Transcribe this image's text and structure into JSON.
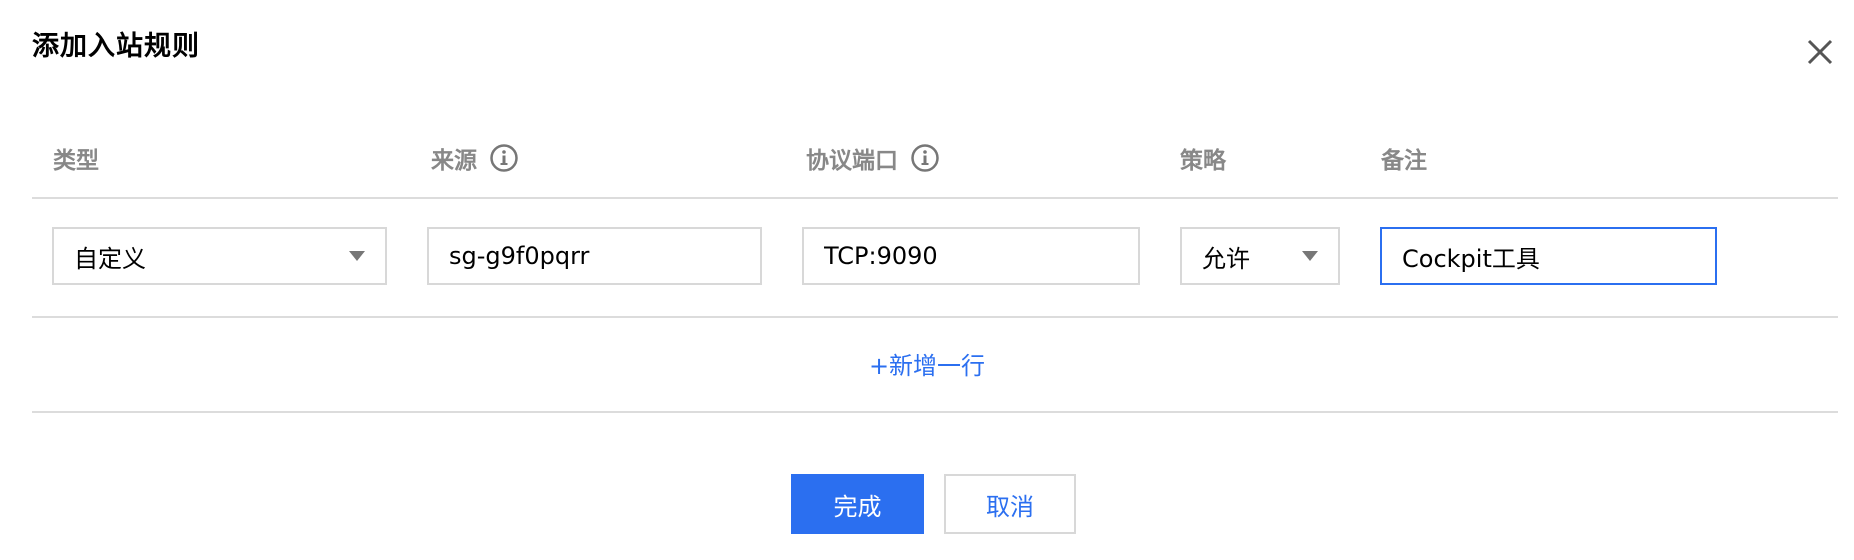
{
  "dialog": {
    "title": "添加入站规则",
    "close_icon": "close-icon"
  },
  "columns": {
    "type": "类型",
    "source": "来源",
    "protocol_port": "协议端口",
    "policy": "策略",
    "remark": "备注",
    "info_icon": "info-icon"
  },
  "row": {
    "type_value": "自定义",
    "source_value": "sg-g9f0pqrr",
    "protocol_port_value": "TCP:9090",
    "policy_value": "允许",
    "remark_value": "Cockpit工具"
  },
  "add_row_label": "+新增一行",
  "buttons": {
    "confirm": "完成",
    "cancel": "取消"
  },
  "colors": {
    "accent": "#2b6ff0",
    "header_text": "#888888",
    "border": "#d8d8d8"
  }
}
